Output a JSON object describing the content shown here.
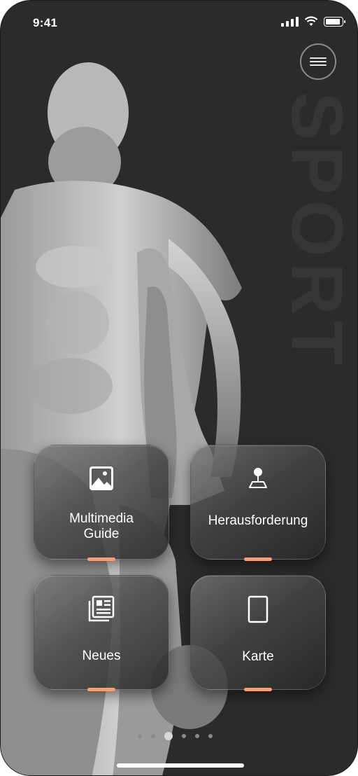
{
  "status_bar": {
    "time": "9:41"
  },
  "watermark": {
    "text": "SPORT"
  },
  "tiles": [
    {
      "label_line1": "Multimedia",
      "label_line2": "Guide",
      "icon": "image-icon"
    },
    {
      "label_line1": "Herausforderung",
      "label_line2": "",
      "icon": "map-pin-icon"
    },
    {
      "label_line1": "Neues",
      "label_line2": "",
      "icon": "news-icon"
    },
    {
      "label_line1": "Karte",
      "label_line2": "",
      "icon": "card-icon"
    }
  ],
  "pager": {
    "count": 6,
    "active_index": 2
  },
  "colors": {
    "background": "#2b2b2b",
    "accent": "#f2a07a",
    "text": "#ffffff"
  }
}
